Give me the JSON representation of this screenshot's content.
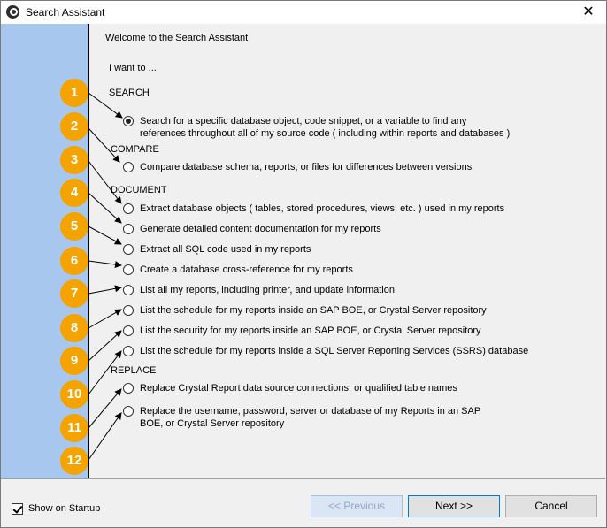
{
  "window": {
    "title": "Search Assistant",
    "close_glyph": "✕"
  },
  "intro": {
    "welcome": "Welcome to the Search Assistant",
    "prompt": "I want to ..."
  },
  "sections": {
    "search": "SEARCH",
    "compare": "COMPARE",
    "document": "DOCUMENT",
    "replace": "REPLACE"
  },
  "options": {
    "search_object_line1": "Search for a specific database object, code snippet, or a variable to find any",
    "search_object_line2": "references throughout all of my source code ( including within reports and databases )",
    "compare_schema": "Compare database schema, reports, or files for differences between versions",
    "extract_objects": "Extract database objects ( tables, stored procedures, views, etc. ) used in my reports",
    "generate_docs": "Generate detailed content documentation for my reports",
    "extract_sql": "Extract all SQL code used in my reports",
    "cross_reference": "Create a database cross-reference for my reports",
    "list_reports": "List all my reports, including printer, and update information",
    "list_schedule_boe": "List the schedule for my reports inside an SAP BOE, or Crystal Server repository",
    "list_security_boe": "List the security for my reports inside an SAP BOE, or Crystal Server repository",
    "list_schedule_ssrs": "List the schedule for my reports inside a SQL Server Reporting Services (SSRS) database",
    "replace_connections": "Replace Crystal Report data source connections, or qualified table names",
    "replace_credentials_line1": "Replace the username, password, server or database of my Reports in an SAP",
    "replace_credentials_line2": "BOE, or Crystal Server repository"
  },
  "selected_option": "search_object",
  "callouts": [
    "1",
    "2",
    "3",
    "4",
    "5",
    "6",
    "7",
    "8",
    "9",
    "10",
    "11",
    "12"
  ],
  "footer": {
    "show_on_startup": "Show on Startup",
    "show_on_startup_checked": true,
    "previous": "<< Previous",
    "next": "Next >>",
    "cancel": "Cancel"
  },
  "colors": {
    "sidebar": "#a7c7ef",
    "callout": "#f4a300",
    "focus": "#0078d7"
  }
}
